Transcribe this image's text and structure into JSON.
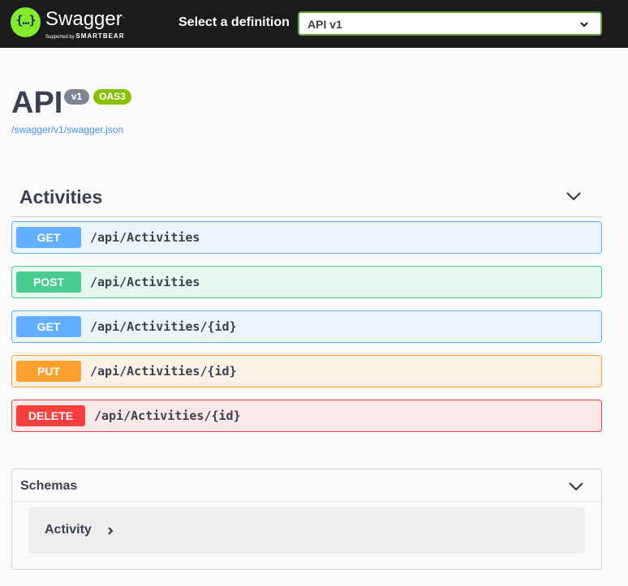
{
  "topbar": {
    "logo_glyph": "{…}",
    "logo_word": "Swagger",
    "logo_sub_prefix": "Supported by",
    "logo_sub_brand": "SMARTBEAR",
    "definition_label": "Select a definition",
    "definition_value": "API v1",
    "accent": "#85ea2d"
  },
  "info": {
    "title": "API",
    "version_badge": "v1",
    "oas_badge": "OAS3",
    "spec_link": "/swagger/v1/swagger.json"
  },
  "tag": {
    "name": "Activities"
  },
  "operations": [
    {
      "method": "GET",
      "path": "/api/Activities",
      "color": "#61affe"
    },
    {
      "method": "POST",
      "path": "/api/Activities",
      "color": "#49cc90"
    },
    {
      "method": "GET",
      "path": "/api/Activities/{id}",
      "color": "#61affe"
    },
    {
      "method": "PUT",
      "path": "/api/Activities/{id}",
      "color": "#fca130"
    },
    {
      "method": "DELETE",
      "path": "/api/Activities/{id}",
      "color": "#f93e3e"
    }
  ],
  "schemas": {
    "title": "Schemas",
    "models": [
      {
        "name": "Activity",
        "icon": "chevron-right-icon"
      }
    ]
  },
  "icons": {
    "definition_select": "chevron-down-icon",
    "tag_toggle": "chevron-down-icon",
    "schemas_toggle": "chevron-down-icon"
  }
}
